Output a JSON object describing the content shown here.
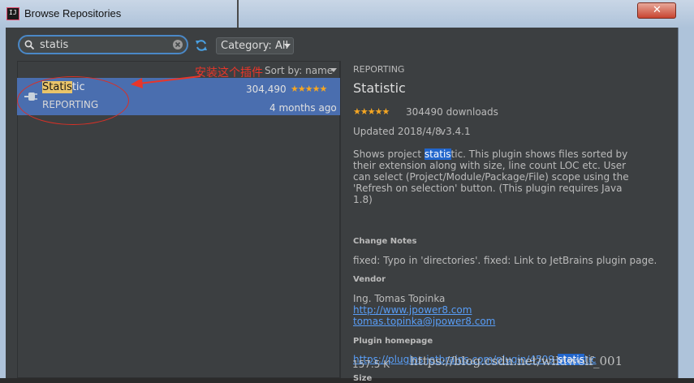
{
  "window": {
    "title": "Browse Repositories"
  },
  "search": {
    "value": "statis"
  },
  "category": {
    "label": "Category: All"
  },
  "list": {
    "sort_label": "Sort by: name",
    "item": {
      "name_highlight": "Statis",
      "name_rest": "tic",
      "category": "REPORTING",
      "downloads": "304,490",
      "rating": 4.5,
      "stars": "★★★★★",
      "updated": "4 months ago"
    }
  },
  "annotation": {
    "text": "安装这个插件",
    "color": "#e8362a"
  },
  "detail": {
    "category": "REPORTING",
    "title": "Statistic",
    "stars": "★★★★★",
    "downloads": "304490 downloads",
    "updated": "Updated 2018/4/8",
    "version": "v3.4.1",
    "desc_pre": "Shows project ",
    "desc_hl": "statis",
    "desc_post": "tic. This plugin shows files sorted by their extension along with size, line count LOC etc. User can select (Project/Module/Package/File) scope using the 'Refresh on selection' button. (This plugin requires Java 1.8)",
    "change_notes_heading": "Change Notes",
    "change_notes": "fixed: Typo in 'directories'. fixed: Link to JetBrains plugin page.",
    "vendor_heading": "Vendor",
    "vendor_name": "Ing. Tomas Topinka",
    "vendor_url": "http://www.jpower8.com",
    "vendor_email": "tomas.topinka@jpower8.com",
    "homepage_heading": "Plugin homepage",
    "homepage_pre": "https://plugins.jetbrains.com/plugin/4509-",
    "homepage_hl": "statis",
    "homepage_post": "tic",
    "size_heading": "Size",
    "size": "157.5 K"
  },
  "watermark": "https://blog.csdn.net/wildwolf_001",
  "colors": {
    "selection": "#4a6eaf",
    "link": "#589df6",
    "star": "#f5a623",
    "highlight": "#e9c46a"
  }
}
